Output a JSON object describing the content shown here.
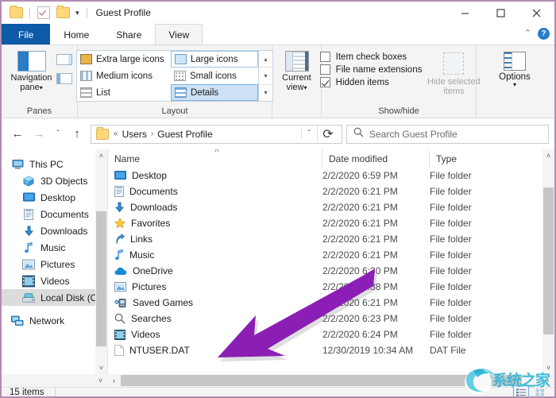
{
  "window": {
    "title": "Guest Profile",
    "quick_access": {
      "folder_icon": "folder-icon",
      "properties_icon": "properties-checkbox-icon",
      "new_folder_icon": "new-folder-icon",
      "customize_caret": "▾"
    },
    "controls": {
      "minimize": "minimize-icon",
      "maximize": "maximize-icon",
      "close": "close-icon"
    },
    "border_color": "#b18cb0"
  },
  "tabs": [
    {
      "label": "File",
      "state": "file-menu"
    },
    {
      "label": "Home",
      "state": "normal"
    },
    {
      "label": "Share",
      "state": "normal"
    },
    {
      "label": "View",
      "state": "active"
    }
  ],
  "ribbon_helpers": {
    "collapse_caret": "⌃",
    "help_label": "?"
  },
  "ribbon": {
    "panes": {
      "group_label": "Panes",
      "navigation_pane_label": "Navigation\npane",
      "navigation_pane_line1": "Navigation",
      "navigation_pane_line2": "pane",
      "caret": "▾",
      "preview_pane_icon": "preview-pane-icon",
      "details_pane_icon": "details-pane-icon"
    },
    "layout": {
      "group_label": "Layout",
      "items": [
        {
          "label": "Extra large icons",
          "selected": false
        },
        {
          "label": "Large icons",
          "selected": false,
          "outlined": true
        },
        {
          "label": "Medium icons",
          "selected": false
        },
        {
          "label": "Small icons",
          "selected": false
        },
        {
          "label": "List",
          "selected": false
        },
        {
          "label": "Details",
          "selected": true
        }
      ],
      "scroll_up": "▴",
      "scroll_down": "▾",
      "scroll_more": "▾"
    },
    "current_view": {
      "group_label": "",
      "line1": "Current",
      "line2": "view",
      "caret": "▾"
    },
    "show_hide": {
      "group_label": "Show/hide",
      "checkboxes": [
        {
          "label": "Item check boxes",
          "checked": false
        },
        {
          "label": "File name extensions",
          "checked": false
        },
        {
          "label": "Hidden items",
          "checked": true
        }
      ],
      "hide_selected_line1": "Hide selected",
      "hide_selected_line2": "items",
      "hide_selected_disabled": true
    },
    "options": {
      "label": "Options",
      "caret": "▾"
    }
  },
  "address_bar": {
    "back_icon": "←",
    "forward_icon": "→",
    "recent_caret": "ˇ",
    "up_icon": "↑",
    "breadcrumb_folder_icon": "folder-icon",
    "breadcrumb_overflow": "«",
    "breadcrumbs": [
      {
        "label": "Users"
      },
      {
        "label": "Guest Profile"
      }
    ],
    "breadcrumb_separator": "›",
    "dropdown_caret": "ˇ",
    "refresh_icon": "⟳",
    "search_placeholder": "Search Guest Profile",
    "search_value": "",
    "search_icon": "search-icon"
  },
  "sidebar": {
    "items": [
      {
        "label": "This PC",
        "icon": "computer-icon",
        "indent": false,
        "selected": false
      },
      {
        "label": "3D Objects",
        "icon": "3d-objects-icon",
        "indent": true,
        "selected": false
      },
      {
        "label": "Desktop",
        "icon": "desktop-icon",
        "indent": true,
        "selected": false
      },
      {
        "label": "Documents",
        "icon": "documents-icon",
        "indent": true,
        "selected": false
      },
      {
        "label": "Downloads",
        "icon": "downloads-icon",
        "indent": true,
        "selected": false
      },
      {
        "label": "Music",
        "icon": "music-icon",
        "indent": true,
        "selected": false
      },
      {
        "label": "Pictures",
        "icon": "pictures-icon",
        "indent": true,
        "selected": false
      },
      {
        "label": "Videos",
        "icon": "videos-icon",
        "indent": true,
        "selected": false
      },
      {
        "label": "Local Disk (C:)",
        "icon": "disk-icon",
        "indent": true,
        "selected": true
      },
      {
        "label": "Network",
        "icon": "network-icon",
        "indent": false,
        "selected": false
      }
    ],
    "scroll_up": "˄",
    "scroll_down": "˅"
  },
  "file_list": {
    "columns": [
      {
        "label": "Name",
        "sorted": "asc",
        "sort_glyph": "˄"
      },
      {
        "label": "Date modified",
        "sorted": null
      },
      {
        "label": "Type",
        "sorted": null
      }
    ],
    "rows": [
      {
        "name": "Desktop",
        "icon": "desktop-folder-icon",
        "date": "2/2/2020 6:59 PM",
        "type": "File folder"
      },
      {
        "name": "Documents",
        "icon": "documents-folder-icon",
        "date": "2/2/2020 6:21 PM",
        "type": "File folder"
      },
      {
        "name": "Downloads",
        "icon": "downloads-folder-icon",
        "date": "2/2/2020 6:21 PM",
        "type": "File folder"
      },
      {
        "name": "Favorites",
        "icon": "favorites-star-icon",
        "date": "2/2/2020 6:21 PM",
        "type": "File folder"
      },
      {
        "name": "Links",
        "icon": "links-icon",
        "date": "2/2/2020 6:21 PM",
        "type": "File folder"
      },
      {
        "name": "Music",
        "icon": "music-folder-icon",
        "date": "2/2/2020 6:21 PM",
        "type": "File folder"
      },
      {
        "name": "OneDrive",
        "icon": "onedrive-cloud-icon",
        "date": "2/2/2020 6:30 PM",
        "type": "File folder"
      },
      {
        "name": "Pictures",
        "icon": "pictures-folder-icon",
        "date": "2/2/2020 6:38 PM",
        "type": "File folder"
      },
      {
        "name": "Saved Games",
        "icon": "saved-games-icon",
        "date": "2/2/2020 6:21 PM",
        "type": "File folder"
      },
      {
        "name": "Searches",
        "icon": "searches-magnifier-icon",
        "date": "2/2/2020 6:23 PM",
        "type": "File folder"
      },
      {
        "name": "Videos",
        "icon": "videos-folder-icon",
        "date": "2/2/2020 6:24 PM",
        "type": "File folder"
      },
      {
        "name": "NTUSER.DAT",
        "icon": "dat-file-icon",
        "date": "12/30/2019 10:34 AM",
        "type": "DAT File"
      }
    ],
    "scroll_up": "˄",
    "scroll_down": "˅",
    "hscroll_left": "‹",
    "hscroll_right": "›"
  },
  "status_bar": {
    "item_count": "15 items",
    "details_view_icon": "details-view-icon",
    "large-icons_view_icon": "large-icons-view-icon"
  },
  "annotation": {
    "arrow_color": "#8b1fb5",
    "type": "arrow",
    "points_to": "NTUSER.DAT"
  },
  "watermark": {
    "text": "系统之家",
    "color": "#2fb6d8"
  }
}
